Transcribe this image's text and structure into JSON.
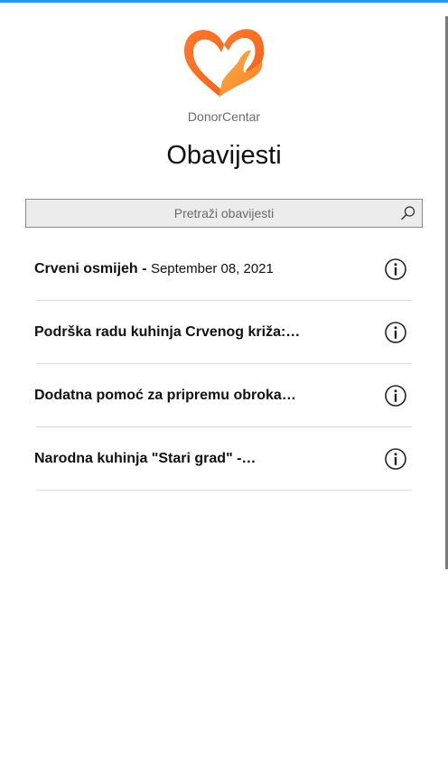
{
  "app": {
    "brand": "DonorCentar",
    "title": "Obavijesti"
  },
  "search": {
    "placeholder": "Pretraži obavijesti",
    "value": ""
  },
  "notifications": [
    {
      "title": "Crveni osmijeh -",
      "date": "September 08, 2021"
    },
    {
      "title": "Podrška radu kuhinja Crvenog križa:…",
      "date": ""
    },
    {
      "title": "Dodatna pomoć za pripremu obroka…",
      "date": ""
    },
    {
      "title": "Narodna kuhinja \"Stari grad\" -…",
      "date": ""
    }
  ],
  "colors": {
    "accent": "#2196f3",
    "logo_orange": "#f36f21",
    "logo_light": "#ffb347"
  },
  "icons": {
    "logo": "heart-hand-logo",
    "search": "search-icon",
    "info": "info-icon"
  }
}
